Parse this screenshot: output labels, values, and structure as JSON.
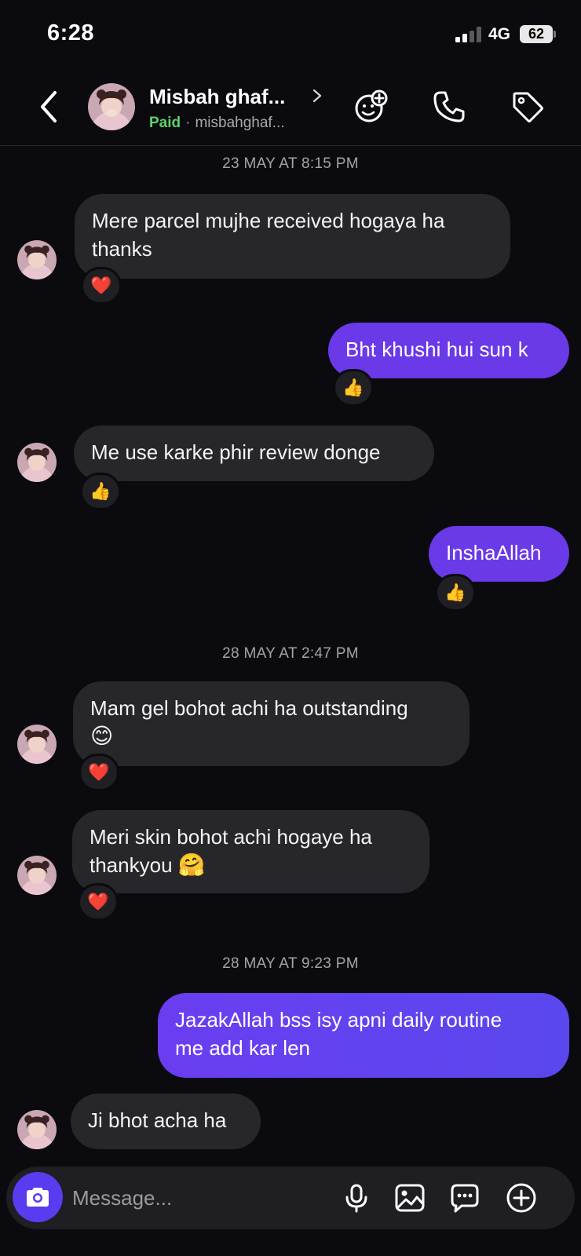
{
  "status_bar": {
    "time": "6:28",
    "network": "4G",
    "battery": "62"
  },
  "header": {
    "contact_name": "Misbah ghaf...",
    "status": "Paid",
    "separator": "·",
    "username": "misbahghaf..."
  },
  "conversation": {
    "dates": [
      "23 MAY AT 8:15 PM",
      "28 MAY AT 2:47 PM",
      "28 MAY AT 9:23 PM"
    ],
    "messages": [
      {
        "from": "contact",
        "line1": "Mere parcel mujhe received hogaya ha",
        "line2": "thanks",
        "reaction": "❤️"
      },
      {
        "from": "me",
        "line1": "Bht khushi hui sun k",
        "reaction": "👍"
      },
      {
        "from": "contact",
        "line1": "Me use karke phir review donge",
        "reaction": "👍"
      },
      {
        "from": "me",
        "line1": "InshaAllah",
        "reaction": "👍"
      },
      {
        "from": "contact",
        "line1": "Mam gel bohot achi ha outstanding",
        "line2": "😊",
        "reaction": "❤️"
      },
      {
        "from": "contact",
        "line1": "Meri skin bohot achi hogaye ha",
        "line2": "thankyou",
        "line2_emoji": "🤗",
        "reaction": "❤️"
      },
      {
        "from": "me",
        "line1": "JazakAllah bss isy apni daily routine",
        "line2": "me add kar len"
      },
      {
        "from": "contact",
        "line1": "Ji bhot acha ha"
      }
    ]
  },
  "composer": {
    "placeholder": "Message..."
  },
  "icons": {
    "back": "chevron-left-icon",
    "add_friend": "add-sticker-icon",
    "call": "phone-icon",
    "label": "tag-icon",
    "camera": "camera-icon",
    "mic": "microphone-icon",
    "gallery": "image-icon",
    "quick_reply": "chat-bubble-icon",
    "more": "plus-circle-icon"
  },
  "colors": {
    "outgoing_bubble": "#6a39e8",
    "incoming_bubble": "#26262b",
    "paid": "#5bd36e",
    "background": "#0b0b0f"
  }
}
